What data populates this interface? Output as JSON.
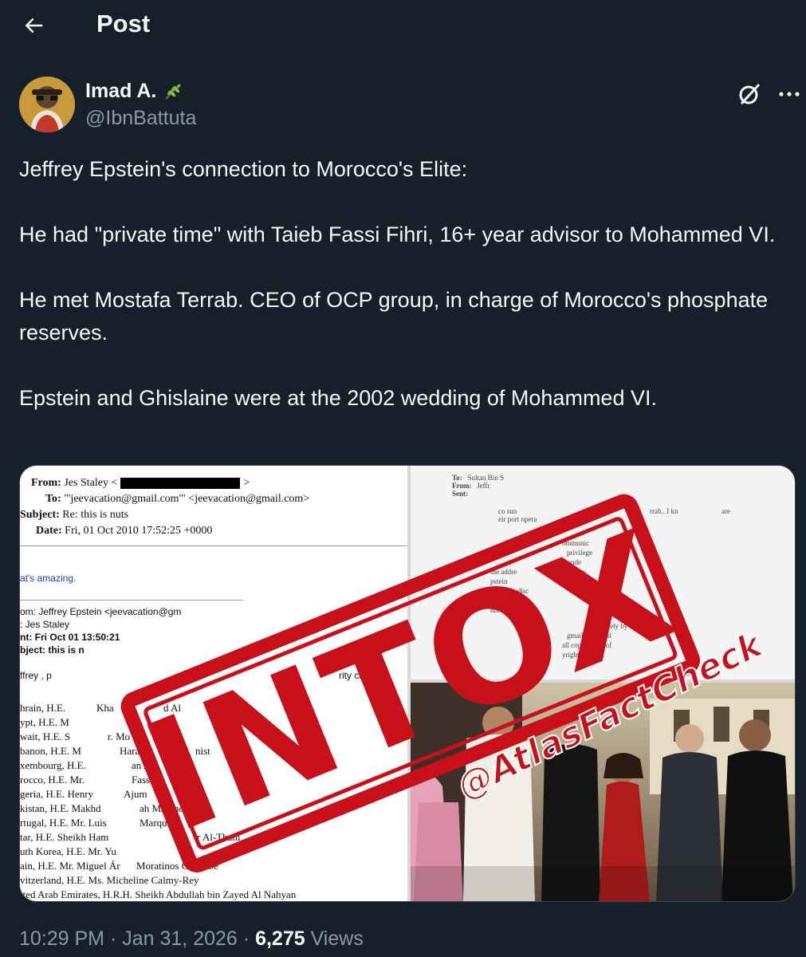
{
  "header": {
    "title": "Post"
  },
  "author": {
    "display_name": "Imad A.",
    "handle": "@IbnBattuta",
    "badge_icon": "olive-branch-emoji"
  },
  "tweet": {
    "paragraphs": [
      "Jeffrey Epstein's connection to Morocco's Elite:",
      "He had \"private time\" with Taieb Fassi Fihri, 16+ year advisor to Mohammed VI.",
      "He met Mostafa Terrab. CEO of OCP group, in charge of Morocco's phosphate reserves.",
      "Epstein and Ghislaine were at the 2002 wedding of Mohammed VI."
    ]
  },
  "media": {
    "stamp_text": "INTOX",
    "watermark": "@AtlasFactCheck",
    "doc_left": {
      "from_label": "From:",
      "from_value": "Jes Staley <",
      "to_label": "To:",
      "to_value": "\"'jeevacation@gmail.com'\" <jeevacation@gmail.com>",
      "subject_label": "Subject:",
      "subject_value": "Re: this is nuts",
      "date_label": "Date:",
      "date_value": "Fri, 01 Oct 2010 17:52:25 +0000",
      "reply_text": "at's amazing.",
      "quoted": [
        "om: Jeffrey Epstein <jeevacation@gm",
        ": Jes Staley",
        "nt: Fri Oct 01 13:50:21",
        "bject: this is n"
      ],
      "body_line": "ffrey , p",
      "body_line_end": "rity cleara",
      "list": [
        "hrain, H.E.",
        "ypt, H.E. M",
        "wait, H.E. S",
        "banon, H.E. M",
        "xembourg, H.E.",
        "rocco, H.E. Mr.",
        "geria, H.E. Henry",
        "kistan, H.E. Makhd",
        "rtugal, H.E. Mr. Luis",
        "tar, H.E. Sheikh Ham",
        "uth Korea, H.E. Mr. Yu",
        "ain, H.E. Mr. Miguel Ár",
        "vitzerland, H.E. Ms. Micheline Calmy-Rey",
        "ited Arab Emirates, H.R.H. Sheikh Abdullah bin Zayed Al Nahyan"
      ],
      "list_fragments": [
        "Kha",
        "d Al",
        "r. Mo",
        "ah",
        "Sabah",
        "Hara",
        "nist",
        "an A",
        "Fassi-",
        "Ajum",
        "ah Mahmood Q",
        "Marqu",
        "r Al-Thani",
        "Moratinos Cuyaubé"
      ]
    },
    "doc_right": {
      "to_label": "To:",
      "to_value": "Sultan Bin S",
      "from_label": "From:",
      "from_value": "Jeffr",
      "sent_label": "Sent:",
      "lines": [
        "co sun",
        "rrab..  I kn",
        "are",
        "eir port opera",
        "ommunic",
        "privilege",
        "ntende",
        "the addre",
        "rty",
        "pstein",
        "ized use, disc",
        "tion or any",
        "nlawful",
        "ely by",
        "gmail.com, and",
        "all copies thereof",
        "yright -all righ"
      ]
    }
  },
  "meta": {
    "time": "10:29 PM",
    "date": "Jan 31, 2026",
    "views_count": "6,275",
    "views_label": "Views"
  },
  "colors": {
    "background": "#15202b",
    "text": "#f7f9f9",
    "secondary": "#8b98a5",
    "stamp_red": "#c8101a"
  }
}
